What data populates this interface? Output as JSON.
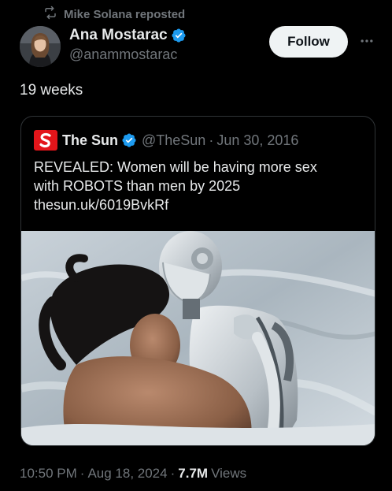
{
  "repost": {
    "label": "Mike Solana reposted",
    "icon": "repost-icon"
  },
  "author": {
    "name": "Ana Mostarac",
    "handle": "@anammostarac",
    "verified": true,
    "avatar": "avatar-photo"
  },
  "actions": {
    "follow_label": "Follow",
    "more_icon": "more-icon"
  },
  "post": {
    "text": "19 weeks"
  },
  "quote": {
    "source_name": "The Sun",
    "handle": "@TheSun",
    "separator": "·",
    "date": "Jun 30, 2016",
    "text_line1": "REVEALED: Women will be having more sex",
    "text_line2": "with ROBOTS than men by 2025",
    "link": "thesun.uk/6019BvkRf",
    "image": "woman-and-robot-photo"
  },
  "footer": {
    "time": "10:50 PM",
    "separator": "·",
    "date": "Aug 18, 2024",
    "separator2": "·",
    "views_count": "7.7M",
    "views_label": "Views"
  },
  "colors": {
    "background": "#000000",
    "text": "#e7e9ea",
    "muted": "#71767b",
    "verified_blue": "#1d9bf0",
    "border": "#2f3336",
    "sun_red": "#e3151a"
  }
}
